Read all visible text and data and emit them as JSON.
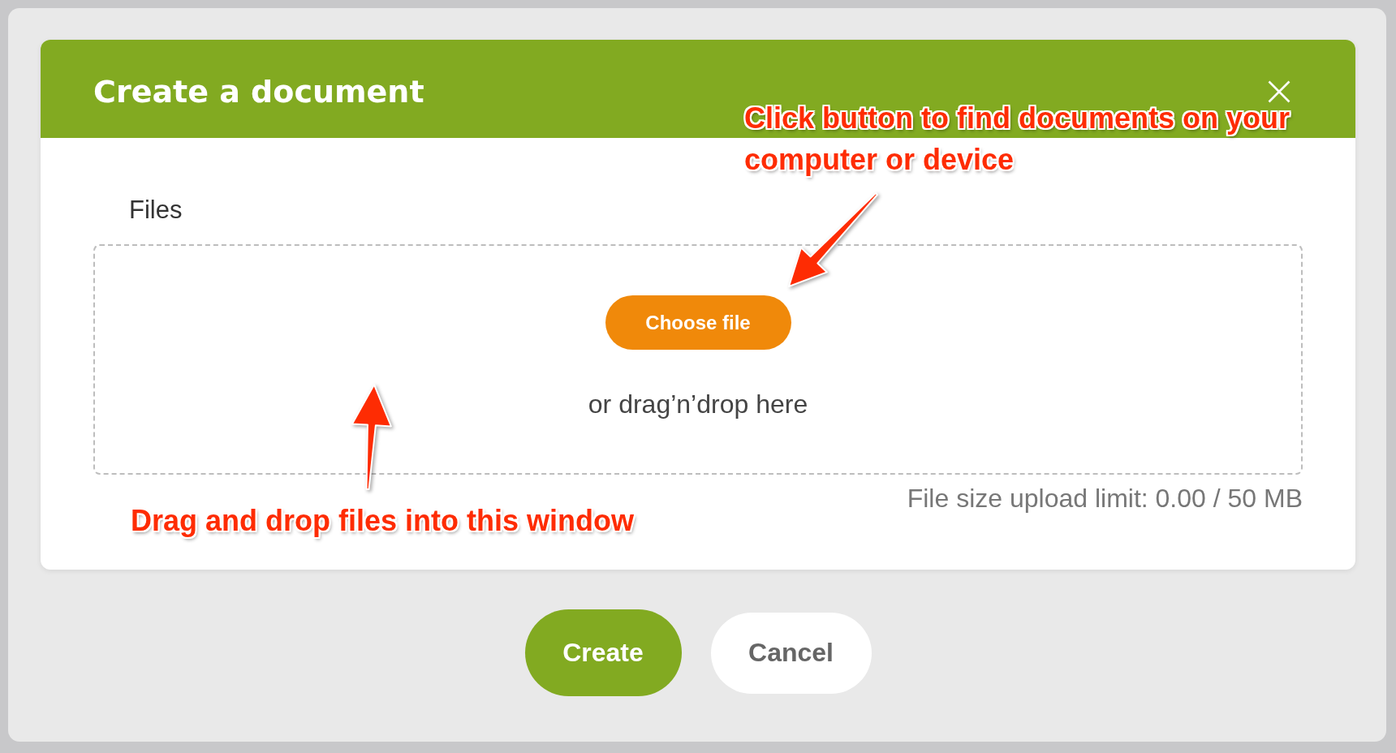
{
  "dialog": {
    "title": "Create a document",
    "field_label": "Files",
    "dropzone": {
      "button": "Choose file",
      "hint": "or drag’n’drop here"
    },
    "size_limit": "File size upload limit: 0.00 / 50 MB"
  },
  "buttons": [
    {
      "label": "Create",
      "kind": "primary"
    },
    {
      "label": "Cancel",
      "kind": "secondary"
    }
  ],
  "annotations": [
    {
      "text": "Click button to find documents on your computer or device"
    },
    {
      "text": "Drag and drop files into this window"
    }
  ]
}
